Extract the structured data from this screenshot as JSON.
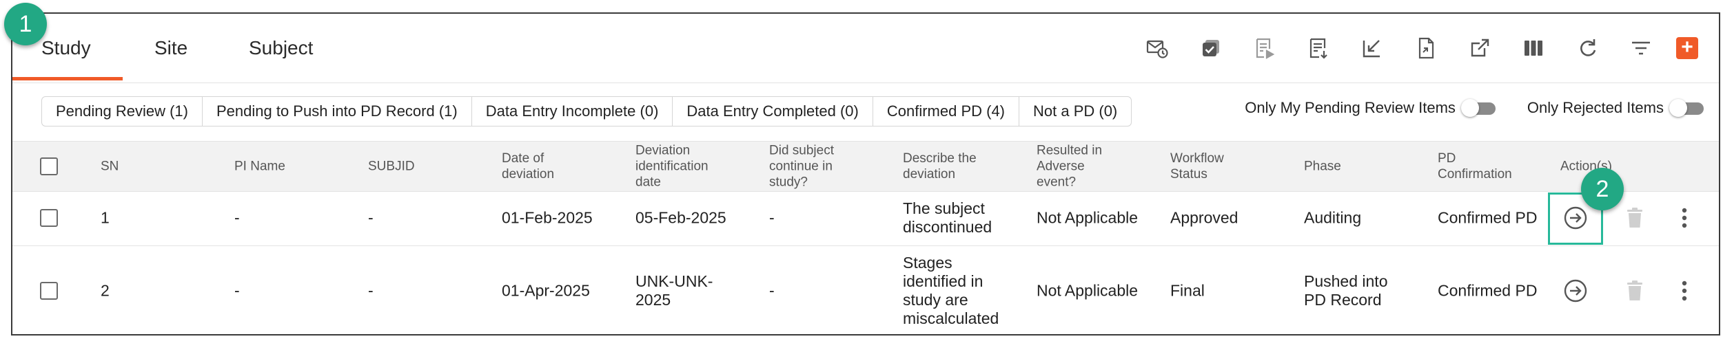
{
  "tabs": [
    {
      "label": "Study"
    },
    {
      "label": "Site"
    },
    {
      "label": "Subject"
    }
  ],
  "toolbar": {
    "icons": [
      "scheduled-mail-icon",
      "bulk-approve-icon",
      "review-list-icon",
      "export-list-icon",
      "edit-sign-icon",
      "pdf-export-icon",
      "open-external-icon",
      "columns-icon",
      "refresh-icon",
      "filter-icon",
      "add-icon"
    ],
    "add_label": "+",
    "accent": "#f05a28"
  },
  "filters": [
    {
      "label": "Pending Review (1)"
    },
    {
      "label": "Pending to Push into PD Record (1)"
    },
    {
      "label": "Data Entry Incomplete (0)"
    },
    {
      "label": "Data Entry Completed (0)"
    },
    {
      "label": "Confirmed PD (4)"
    },
    {
      "label": "Not a PD (0)"
    }
  ],
  "toggles": [
    {
      "label": "Only My Pending Review Items",
      "on": false
    },
    {
      "label": "Only Rejected Items",
      "on": false
    }
  ],
  "table": {
    "headers": {
      "sn": "SN",
      "pi_name": "PI Name",
      "subjid": "SUBJID",
      "date_of_deviation": [
        "Date of",
        "deviation"
      ],
      "deviation_identification_date": [
        "Deviation",
        "identification",
        "date"
      ],
      "did_subject_continue": [
        "Did subject",
        "continue in",
        "study?"
      ],
      "describe": [
        "Describe the",
        "deviation"
      ],
      "adverse": [
        "Resulted in",
        "Adverse",
        "event?"
      ],
      "workflow": [
        "Workflow",
        "Status"
      ],
      "phase": "Phase",
      "pd_confirmation": [
        "PD",
        "Confirmation"
      ],
      "actions": "Action(s)"
    },
    "rows": [
      {
        "sn": "1",
        "pi_name": "-",
        "subjid": "-",
        "date_of_deviation": "01-Feb-2025",
        "deviation_identification_date": [
          "05-Feb-2025"
        ],
        "did_subject_continue": "-",
        "describe": [
          "The subject",
          "discontinued"
        ],
        "adverse": "Not Applicable",
        "workflow": "Approved",
        "phase": [
          "Auditing"
        ],
        "pd_confirmation": "Confirmed PD"
      },
      {
        "sn": "2",
        "pi_name": "-",
        "subjid": "-",
        "date_of_deviation": "01-Apr-2025",
        "deviation_identification_date": [
          "UNK-UNK-",
          "2025"
        ],
        "did_subject_continue": "-",
        "describe": [
          "Stages",
          "identified in",
          "study are",
          "miscalculated"
        ],
        "adverse": "Not Applicable",
        "workflow": "Final",
        "phase": [
          "Pushed into",
          "PD Record"
        ],
        "pd_confirmation": "Confirmed PD"
      }
    ]
  },
  "annotations": [
    {
      "label": "1",
      "color": "#22a884"
    },
    {
      "label": "2",
      "color": "#22a884"
    }
  ]
}
